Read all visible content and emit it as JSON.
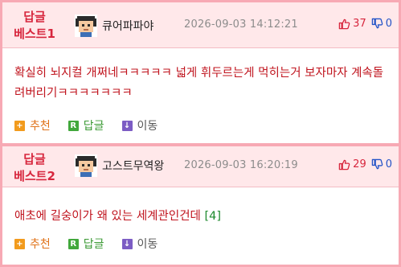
{
  "comments": [
    {
      "best_label": [
        "답글",
        "베스트1"
      ],
      "nickname": "큐어파파야",
      "datetime": "2026-09-03 14:12:21",
      "up_count": "37",
      "down_count": "0",
      "text": "확실히 뇌지컬 개쩌네ㅋㅋㅋㅋㅋ 넓게 휘두르는게 먹히는거 보자마자 계속돌려버리기ㅋㅋㅋㅋㅋㅋㅋ",
      "reply_count": "",
      "actions": {
        "recommend": "추천",
        "reply": "답글",
        "move": "이동"
      }
    },
    {
      "best_label": [
        "답글",
        "베스트2"
      ],
      "nickname": "고스트무역왕",
      "datetime": "2026-09-03 16:20:19",
      "up_count": "29",
      "down_count": "0",
      "text": "애초에 길숭이가 왜 있는 세계관인건데",
      "reply_count": "[4]",
      "actions": {
        "recommend": "추천",
        "reply": "답글",
        "move": "이동"
      }
    }
  ],
  "colors": {
    "accent_red": "#d7263d",
    "body_text": "#c0141e",
    "header_bg": "#ffe8ea",
    "frame_bg": "#f7a9b4",
    "recommend": "#f29b1d",
    "reply": "#42a83c",
    "move": "#7c5cc4"
  },
  "icons": {
    "avatar": "pixel-avatar-icon",
    "upvote": "thumbs-up-icon",
    "downvote": "thumbs-down-icon",
    "recommend": "plus-square-icon",
    "reply": "r-square-icon",
    "move": "down-arrow-square-icon"
  }
}
